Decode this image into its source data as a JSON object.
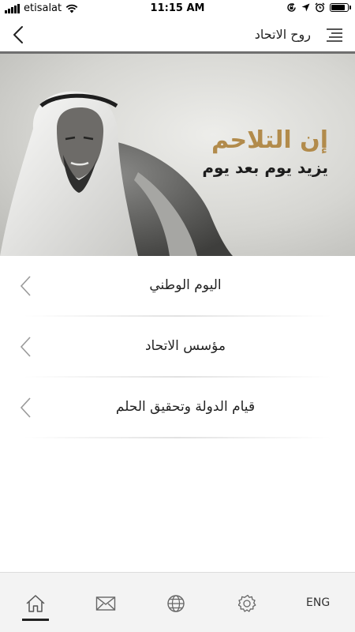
{
  "status_bar": {
    "carrier": "etisalat",
    "time": "11:15 AM",
    "battery_level": 0.9,
    "icons": [
      "signal-icon",
      "wifi-icon",
      "lock-rotation-icon",
      "location-arrow-icon",
      "alarm-icon",
      "battery-icon"
    ]
  },
  "navbar": {
    "title": "روح الاتحاد",
    "back_icon": "chevron-left-icon",
    "menu_icon": "hamburger-menu-icon"
  },
  "hero": {
    "title_line1": "إن التلاحم",
    "title_line2": "يزيد يوم بعد يوم",
    "accent_color": "#b28b4b"
  },
  "menu": {
    "items": [
      {
        "label": "اليوم الوطني"
      },
      {
        "label": "مؤسس الاتحاد"
      },
      {
        "label": "قيام الدولة وتحقيق الحلم"
      }
    ]
  },
  "tabbar": {
    "active_tab": "home",
    "icons": [
      "home-icon",
      "mail-icon",
      "globe-icon",
      "gear-icon"
    ],
    "language_label": "ENG"
  }
}
